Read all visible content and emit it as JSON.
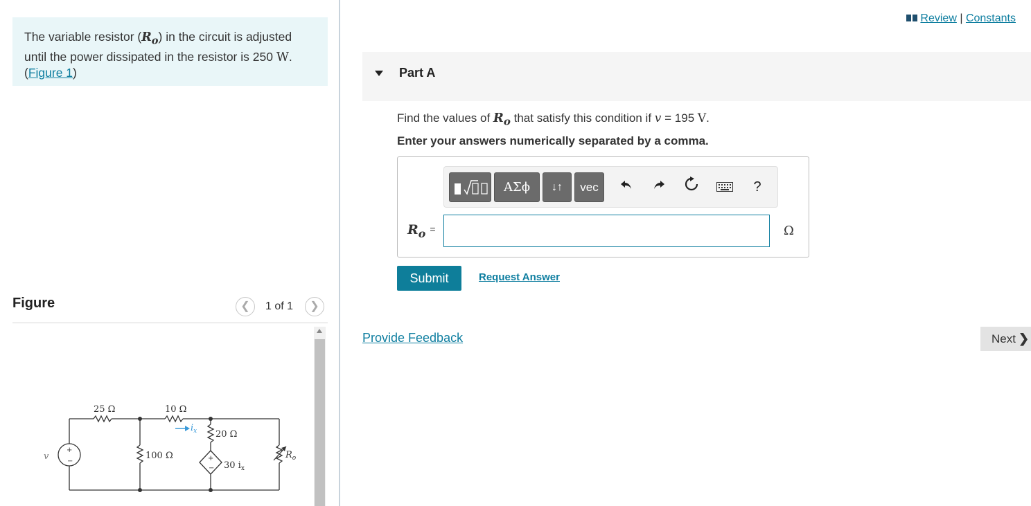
{
  "intro": {
    "text_before": "The variable resistor (",
    "symbol": "R",
    "symbol_sub": "o",
    "text_mid": ") in the circuit is adjusted until the power dissipated in the resistor is 250 ",
    "unit": "W",
    "text_end": ".",
    "figure_link": "Figure 1"
  },
  "figure": {
    "title": "Figure",
    "pager": "1 of 1",
    "prev_icon": "chevron-left-icon",
    "next_icon": "chevron-right-icon"
  },
  "circuit": {
    "labels": {
      "r25": "25 Ω",
      "r10": "10 Ω",
      "r100": "100 Ω",
      "r20": "20 Ω",
      "ix": "i",
      "ix_sub": "x",
      "dep_source": "30 i",
      "dep_sub": "x",
      "ro": "R",
      "ro_sub": "o",
      "v": "v",
      "plus": "+",
      "minus": "−"
    }
  },
  "header": {
    "review": "Review",
    "separator": "|",
    "constants": "Constants"
  },
  "part": {
    "title": "Part A",
    "question_before": "Find the values of ",
    "question_sym": "R",
    "question_sub": "o",
    "question_mid": " that satisfy this condition if ",
    "question_var": "v",
    "question_eq": " = 195 ",
    "question_unit": "V",
    "question_end": ".",
    "instruction": "Enter your answers numerically separated by a comma."
  },
  "toolbar": {
    "templates_icon": "templates-icon",
    "greek_label": "ΑΣϕ",
    "arrows_label": "↓↑",
    "vec_label": "vec",
    "undo_icon": "undo-icon",
    "redo_icon": "redo-icon",
    "reset_icon": "reset-icon",
    "keyboard_icon": "keyboard-icon",
    "help_label": "?"
  },
  "answer": {
    "label_sym": "R",
    "label_sub": "o",
    "label_eq": "=",
    "value": "",
    "unit": "Ω"
  },
  "actions": {
    "submit": "Submit",
    "request_answer": "Request Answer",
    "feedback": "Provide Feedback",
    "next": "Next",
    "next_chevron": "❯"
  },
  "colors": {
    "accent": "#0e7e9a",
    "intro_bg": "#e9f6f8",
    "part_bar": "#f5f5f5",
    "circuit_arrow": "#3a9ad9"
  }
}
